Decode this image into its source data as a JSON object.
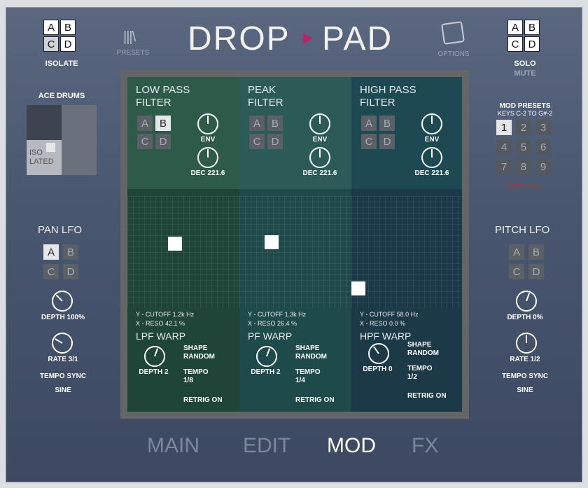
{
  "header": {
    "logo_left": "DROP",
    "logo_right": "PAD",
    "presets": "PRESETS",
    "options": "OPTIONS"
  },
  "isolate": {
    "label": "ISOLATE",
    "cells": [
      "A",
      "B",
      "C",
      "D"
    ]
  },
  "solo": {
    "label": "SOLO",
    "mute": "MUTE",
    "cells": [
      "A",
      "B",
      "C",
      "D"
    ]
  },
  "ace": {
    "label": "ACE DRUMS",
    "isolated": "ISO\nLATED"
  },
  "pan": {
    "title": "PAN LFO",
    "cells": [
      "A",
      "B",
      "C",
      "D"
    ],
    "depth": "DEPTH 100%",
    "rate": "RATE 3/1",
    "sync": "TEMPO SYNC",
    "shape": "SINE"
  },
  "pitch": {
    "title": "PITCH LFO",
    "cells": [
      "A",
      "B",
      "C",
      "D"
    ],
    "depth": "DEPTH 0%",
    "rate": "RATE 1/2",
    "sync": "TEMPO SYNC",
    "shape": "SINE"
  },
  "modpresets": {
    "title": "MOD PRESETS",
    "keys": "KEYS C-2 TO G#-2",
    "nums": [
      "1",
      "2",
      "3",
      "4",
      "5",
      "6",
      "7",
      "8",
      "9"
    ],
    "copy": "COPY TO..."
  },
  "filters": [
    {
      "title1": "LOW PASS",
      "title2": "FILTER",
      "env": "ENV",
      "dec": "DEC 221.6",
      "ycut": "Y - CUTOFF  1.2k Hz",
      "xres": "X - RESO 42.1 %",
      "warp": "LPF WARP",
      "depth": "DEPTH 2",
      "shape1": "SHAPE",
      "shape2": "RANDOM",
      "tempo1": "TEMPO",
      "tempo2": "1/8",
      "retrig": "RETRIG ON",
      "cells": [
        "A",
        "B",
        "C",
        "D"
      ],
      "dot": [
        0.38,
        0.42
      ]
    },
    {
      "title1": "PEAK",
      "title2": "FILTER",
      "env": "ENV",
      "dec": "DEC 221.6",
      "ycut": "Y - CUTOFF  1.3k Hz",
      "xres": "X - RESO 26.4 %",
      "warp": "PF WARP",
      "depth": "DEPTH 2",
      "shape1": "SHAPE",
      "shape2": "RANDOM",
      "tempo1": "TEMPO",
      "tempo2": "1/4",
      "retrig": "RETRIG ON",
      "cells": [
        "A",
        "B",
        "C",
        "D"
      ]
    },
    {
      "title1": "HIGH PASS",
      "title2": "FILTER",
      "env": "ENV",
      "dec": "DEC 221.6",
      "ycut": "Y - CUTOFF  58.0 Hz",
      "xres": "X - RESO 0.0 %",
      "warp": "HPF WARP",
      "depth": "DEPTH 0",
      "shape1": "SHAPE",
      "shape2": "RANDOM",
      "tempo1": "TEMPO",
      "tempo2": "1/2",
      "retrig": "RETRIG ON",
      "cells": [
        "A",
        "B",
        "C",
        "D"
      ]
    }
  ],
  "tabs": [
    "MAIN",
    "EDIT",
    "MOD",
    "FX"
  ]
}
